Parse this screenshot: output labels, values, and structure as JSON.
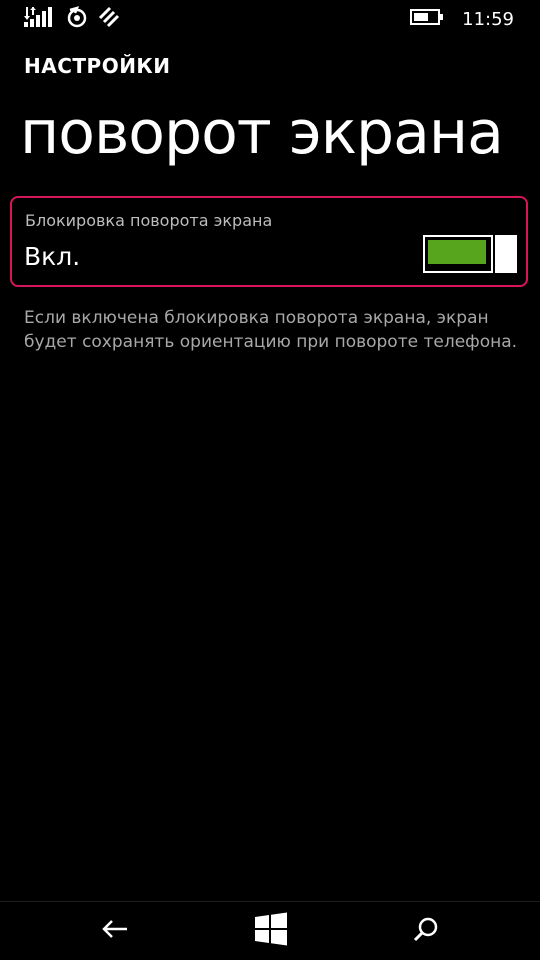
{
  "status_bar": {
    "time": "11:59",
    "icons": [
      "signal-icon",
      "data-saver-icon",
      "wifi-icon",
      "battery-icon"
    ]
  },
  "header": {
    "app_title": "НАСТРОЙКИ",
    "page_title": "поворот экрана"
  },
  "setting": {
    "label": "Блокировка поворота экрана",
    "value": "Вкл.",
    "toggle_on": true
  },
  "description": "Если включена блокировка поворота экрана, экран будет сохранять ориентацию при повороте телефона.",
  "nav_bar": {
    "icons": [
      "back-arrow-icon",
      "windows-icon",
      "search-icon"
    ]
  },
  "colors": {
    "background": "#000000",
    "accent": "#d6155a",
    "toggle_on": "#57a51d",
    "label_gray": "#bdbdbd",
    "description_gray": "#a8a8a8"
  }
}
